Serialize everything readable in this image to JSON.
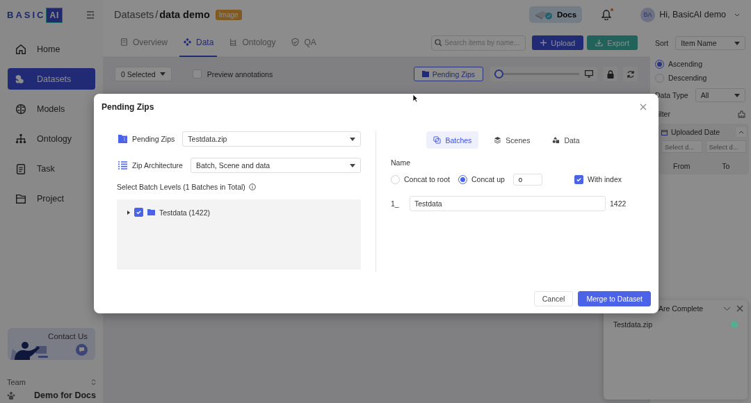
{
  "header": {
    "logo": {
      "text": "BASIC",
      "badge": "AI"
    },
    "breadcrumb": {
      "parent": "Datasets",
      "separator": "/",
      "current": "data demo",
      "tag": "Image"
    },
    "docs_button": "Docs",
    "notifications": {
      "unread": true
    },
    "user": {
      "initials": "BA",
      "greeting": "Hi, BasicAI demo"
    }
  },
  "sidebar": {
    "items": [
      {
        "label": "Home",
        "selected": false
      },
      {
        "label": "Datasets",
        "selected": true
      },
      {
        "label": "Models",
        "selected": false
      },
      {
        "label": "Ontology",
        "selected": false
      },
      {
        "label": "Task",
        "selected": false
      },
      {
        "label": "Project",
        "selected": false
      }
    ],
    "contact": "Contact Us",
    "team_label": "Team",
    "team": "Demo for Docs"
  },
  "tabs": [
    {
      "label": "Overview",
      "selected": false
    },
    {
      "label": "Data",
      "selected": true
    },
    {
      "label": "Ontology",
      "selected": false
    },
    {
      "label": "QA",
      "selected": false
    }
  ],
  "search": {
    "placeholder": "Search items by name..."
  },
  "upload_button": "Upload",
  "export_button": "Export",
  "toolbar": {
    "selection": "0 Selected",
    "preview": {
      "label": "Preview annotations",
      "checked": false
    },
    "pending_button": "Pending Zips",
    "zoom": {
      "level": 0.05
    }
  },
  "right_panel": {
    "sort_label": "Sort",
    "sort_value": "Item Name",
    "order": [
      {
        "label": "Ascending",
        "selected": true
      },
      {
        "label": "Descending",
        "selected": false
      }
    ],
    "data_type_label": "Data Type",
    "data_type_value": "All",
    "filter_label": "ilter",
    "date_filter": {
      "title": "Uploaded Date",
      "expanded": true,
      "start_placeholder": "Select d...",
      "end_placeholder": "Select d...",
      "from": "From",
      "to": "To"
    }
  },
  "upload_panel": {
    "title": "Are Complete",
    "files": [
      {
        "name": "Testdata.zip",
        "color": "#4fb093"
      }
    ]
  },
  "modal": {
    "title": "Pending Zips",
    "fields": [
      {
        "label": "Pending Zips",
        "value": "Testdata.zip"
      },
      {
        "label": "Zip Architecture",
        "value": "Batch, Scene and data"
      }
    ],
    "levels_label": "Select Batch Levels (1 Batches in Total)",
    "tree": [
      {
        "label": "Testdata (1422)",
        "checked": true,
        "expanded": false
      }
    ],
    "view_tabs": [
      {
        "label": "Batches",
        "selected": true
      },
      {
        "label": "Scenes",
        "selected": false
      },
      {
        "label": "Data",
        "selected": false
      }
    ],
    "name_label": "Name",
    "name_modes": [
      {
        "label": "Concat to root",
        "selected": false
      },
      {
        "label": "Concat up",
        "selected": true
      }
    ],
    "concat_level": "0",
    "with_index": {
      "label": "With index",
      "checked": true
    },
    "rows": [
      {
        "index": "1_",
        "name": "Testdata",
        "count": "1422"
      }
    ],
    "cancel": "Cancel",
    "confirm": "Merge to Dataset"
  }
}
